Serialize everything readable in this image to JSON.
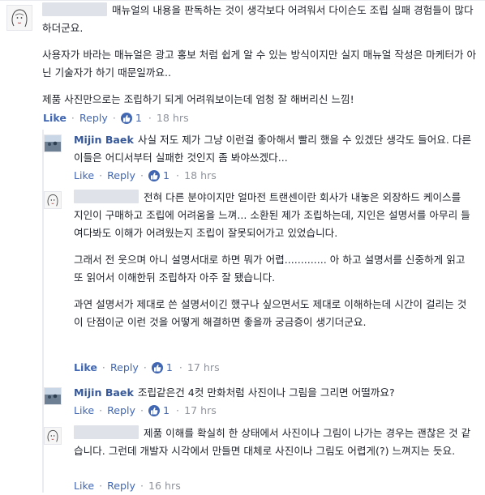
{
  "comments": [
    {
      "author": "",
      "paragraphs": [
        "매뉴얼의 내용을 판독하는 것이 생각보다 어려워서 다이슨도 조립 실패 경험들이 많다 하더군요.",
        "사용자가 바라는 매뉴얼은 광고 홍보 처럼 쉽게 알 수 있는 방식이지만 실지 매뉴얼 작성은 마케터가 아닌 기술자가 하기 때문일까요..",
        "제품 사진만으로는 조립하기 되게 어려워보이는데 엄청 잘 해버리신 느낌!"
      ],
      "like": "Like",
      "reply": "Reply",
      "likes": "1",
      "time": "18 hrs"
    },
    {
      "author": "Mijin Baek",
      "paragraphs": [
        "사실 저도 제가 그냥 이런걸 좋아해서 빨리 했을 수 있겠단 생각도 들어요. 다른이들은 어디서부터 실패한 것인지 좀 봐야쓰겠다..."
      ],
      "like": "Like",
      "reply": "Reply",
      "likes": "1",
      "time": "18 hrs"
    },
    {
      "author": "",
      "paragraphs": [
        "전혀 다른 분야이지만 얼마전 트랜센이란 회사가 내놓은 외장하드 케이스를 지인이 구매하고 조립에 어려움을 느껴... 소환된 제가 조립하는데, 지인은 설명서를 아무리 들여다봐도 이해가 어려웠는지 조립이 잘못되어가고 있었습니다.",
        "그래서 전 웃으며 아니 설명서대로 하면 뭐가 어렵............. 아 하고 설명서를 신중하게 읽고 또 읽어서 이해한뒤 조립하자 아주 잘 됐습니다.",
        "과연 설명서가 제대로 쓴 설명서이긴 했구나 싶으면서도 제대로 이해하는데 시간이 걸리는 것이 단점이군 이런 것을 어떻게 해결하면 좋을까 궁금증이 생기더군요."
      ],
      "like": "Like",
      "reply": "Reply",
      "likes": "1",
      "time": "17 hrs"
    },
    {
      "author": "Mijin Baek",
      "paragraphs": [
        "조립같은건 4컷 만화처럼 사진이나 그림을 그리면 어떨까요?"
      ],
      "like": "Like",
      "reply": "Reply",
      "likes": "1",
      "time": "17 hrs"
    },
    {
      "author": "",
      "paragraphs": [
        "제품 이해를 확실히 한 상태에서 사진이나 그림이 나가는 경우는 괜찮은 것 같습니다. 그런데 개발자 시각에서 만들면 대체로 사진이나 그림도 어렵게(?) 느껴지는 듯요."
      ],
      "like": "Like",
      "reply": "Reply",
      "time": "16 hrs"
    }
  ],
  "colors": {
    "link": "#4267b2",
    "author": "#365899",
    "meta": "#90949c",
    "text": "#1d2129"
  }
}
